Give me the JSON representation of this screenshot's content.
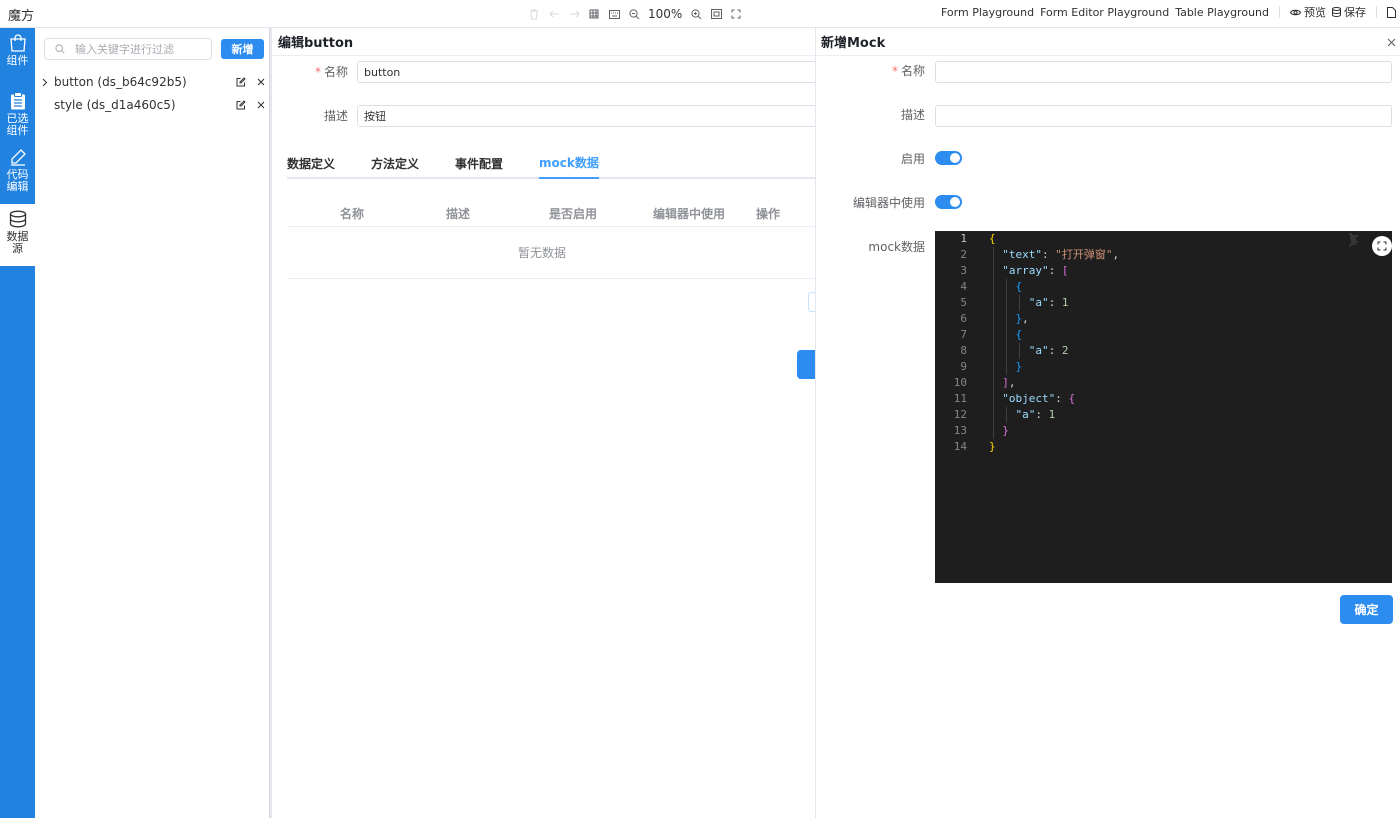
{
  "app": {
    "title": "魔方"
  },
  "toolbar": {
    "zoom": "100%",
    "icons": [
      "delete-icon",
      "undo-icon",
      "redo-icon",
      "grid-icon",
      "keyboard-icon",
      "zoom-out-icon",
      "zoom-in-icon",
      "fit-icon",
      "fullscreen-icon"
    ]
  },
  "topnav": {
    "links": [
      "Form Playground",
      "Form Editor Playground",
      "Table Playground"
    ],
    "preview": "预览",
    "save": "保存"
  },
  "rail": {
    "items": [
      {
        "label": "组件",
        "icon": "bag-icon"
      },
      {
        "label": "已选组件",
        "icon": "clipboard-icon"
      },
      {
        "label": "代码编辑",
        "icon": "pencil-icon"
      },
      {
        "label": "数据源",
        "icon": "database-icon",
        "active": true
      }
    ]
  },
  "datasource": {
    "search_placeholder": "输入关键字进行过滤",
    "add_label": "新增",
    "items": [
      {
        "name": "button (ds_b64c92b5)",
        "expandable": true
      },
      {
        "name": "style (ds_d1a460c5)",
        "expandable": false
      }
    ]
  },
  "editor": {
    "title": "编辑button",
    "name_label": "名称",
    "name_value": "button",
    "desc_label": "描述",
    "desc_value": "按钮",
    "tabs": [
      "数据定义",
      "方法定义",
      "事件配置",
      "mock数据"
    ],
    "active_tab": "mock数据",
    "table": {
      "columns": [
        "名称",
        "描述",
        "是否启用",
        "编辑器中使用",
        "操作"
      ],
      "empty_text": "暂无数据"
    }
  },
  "mock_drawer": {
    "title": "新增Mock",
    "name_label": "名称",
    "name_value": "",
    "desc_label": "描述",
    "desc_value": "",
    "enable_label": "启用",
    "enabled": true,
    "editor_use_label": "编辑器中使用",
    "editor_use": true,
    "mock_label": "mock数据",
    "confirm_label": "确定",
    "code_lines": [
      "{",
      "  \"text\": \"打开弹窗\",",
      "  \"array\": [",
      "    {",
      "      \"a\": 1",
      "    },",
      "    {",
      "      \"a\": 2",
      "    }",
      "  ],",
      "  \"object\": {",
      "    \"a\": 1",
      "  }",
      "}"
    ]
  },
  "colors": {
    "primary": "#2d8cf0",
    "rail": "#2182e0",
    "tab_active": "#409eff",
    "required": "#f56c6c",
    "code_bg": "#1e1e1e"
  }
}
